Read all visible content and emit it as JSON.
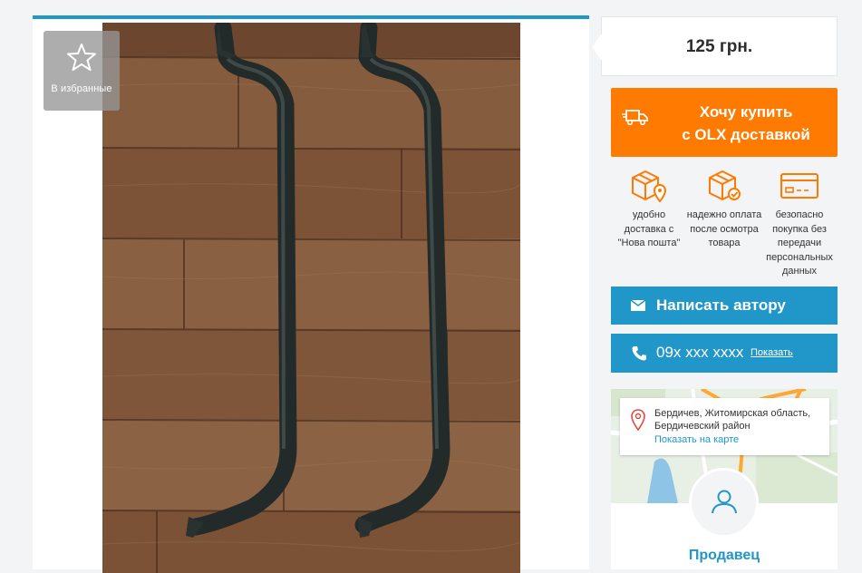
{
  "favorite": {
    "label": "В избранные",
    "icon": "star-icon"
  },
  "price": {
    "value": "125 грн."
  },
  "buy_button": {
    "line1": "Хочу купить",
    "line2": "с OLX доставкой",
    "icon": "truck-icon"
  },
  "features": [
    {
      "icon": "box-location-icon",
      "text": "удобно доставка с \"Нова пошта\""
    },
    {
      "icon": "box-check-icon",
      "text": "надежно оплата после осмотра товара"
    },
    {
      "icon": "card-icon",
      "text": "безопасно покупка без передачи персональных данных"
    }
  ],
  "message_button": {
    "label": "Написать автору",
    "icon": "envelope-icon"
  },
  "phone_button": {
    "number": "09x xxx xxxx",
    "show_label": "Показать",
    "icon": "phone-icon"
  },
  "location": {
    "text": "Бердичев, Житомирская область, Бердичевский район",
    "map_link": "Показать на карте"
  },
  "seller": {
    "label": "Продавец"
  },
  "colors": {
    "accent_blue": "#2196c9",
    "accent_orange": "#ff7a00",
    "background": "#f2f4f5"
  }
}
